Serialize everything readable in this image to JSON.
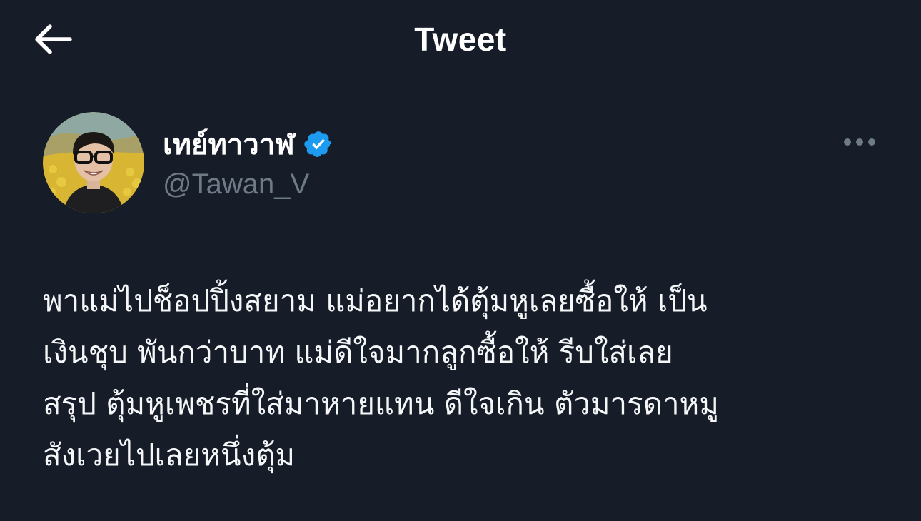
{
  "header": {
    "title": "Tweet",
    "back_icon": "arrow-left-icon"
  },
  "author": {
    "display_name": "เทย์ทาวาฬ",
    "handle": "@Tawan_V",
    "verified": true,
    "verified_icon": "verified-badge-icon",
    "verified_color": "#1d9bf0"
  },
  "more_icon": "more-horizontal-icon",
  "tweet": {
    "lines": [
      "พาแม่ไปช็อปปิ้งสยาม แม่อยากได้ตุ้มหูเลยซื้อให้ เป็น",
      "เงินชุบ พันกว่าบาท แม่ดีใจมากลูกซื้อให้ รีบใส่เลย",
      "สรุป ตุ้มหูเพชรที่ใส่มาหายแทน ดีใจเกิน ตัวมารดาหมู",
      "สังเวยไปเลยหนึ่งตุ้ม"
    ]
  },
  "colors": {
    "background": "#161c28",
    "text_primary": "#ffffff",
    "text_secondary": "#6f7a87"
  }
}
